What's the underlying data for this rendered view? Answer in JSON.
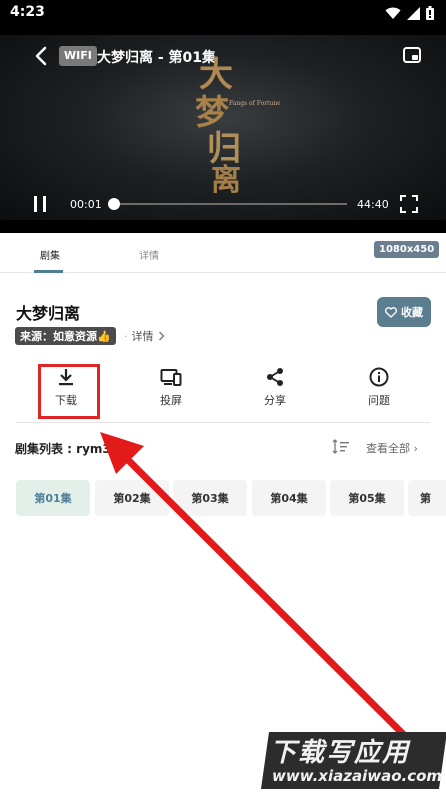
{
  "status_bar": {
    "time": "4:23"
  },
  "player": {
    "wifi_badge": "WIFI",
    "title": "大梦归离 - 第01集",
    "poster_art": {
      "main": "大梦归离",
      "sub": "Fangs of Fortune"
    },
    "current_time": "00:01",
    "duration": "44:40",
    "progress": 0.0
  },
  "tabs": {
    "episodes": "剧集",
    "details": "详情",
    "size_badge": "1080x450"
  },
  "info": {
    "title": "大梦归离",
    "source": "来源：如意资源👍",
    "separator": "·",
    "detail_link": "详情",
    "favorite": "收藏"
  },
  "actions": {
    "download": "下载",
    "cast": "投屏",
    "share": "分享",
    "issue": "问题"
  },
  "episode_list": {
    "title": "剧集列表 : rym3u8",
    "view_all": "查看全部",
    "episodes": [
      "第01集",
      "第02集",
      "第03集",
      "第04集",
      "第05集",
      "第"
    ]
  },
  "watermark": {
    "big": "下载写应用",
    "small": "www.xiazaiwao.com"
  },
  "colors": {
    "accent": "#4f7f96",
    "highlight": "#e02424"
  }
}
